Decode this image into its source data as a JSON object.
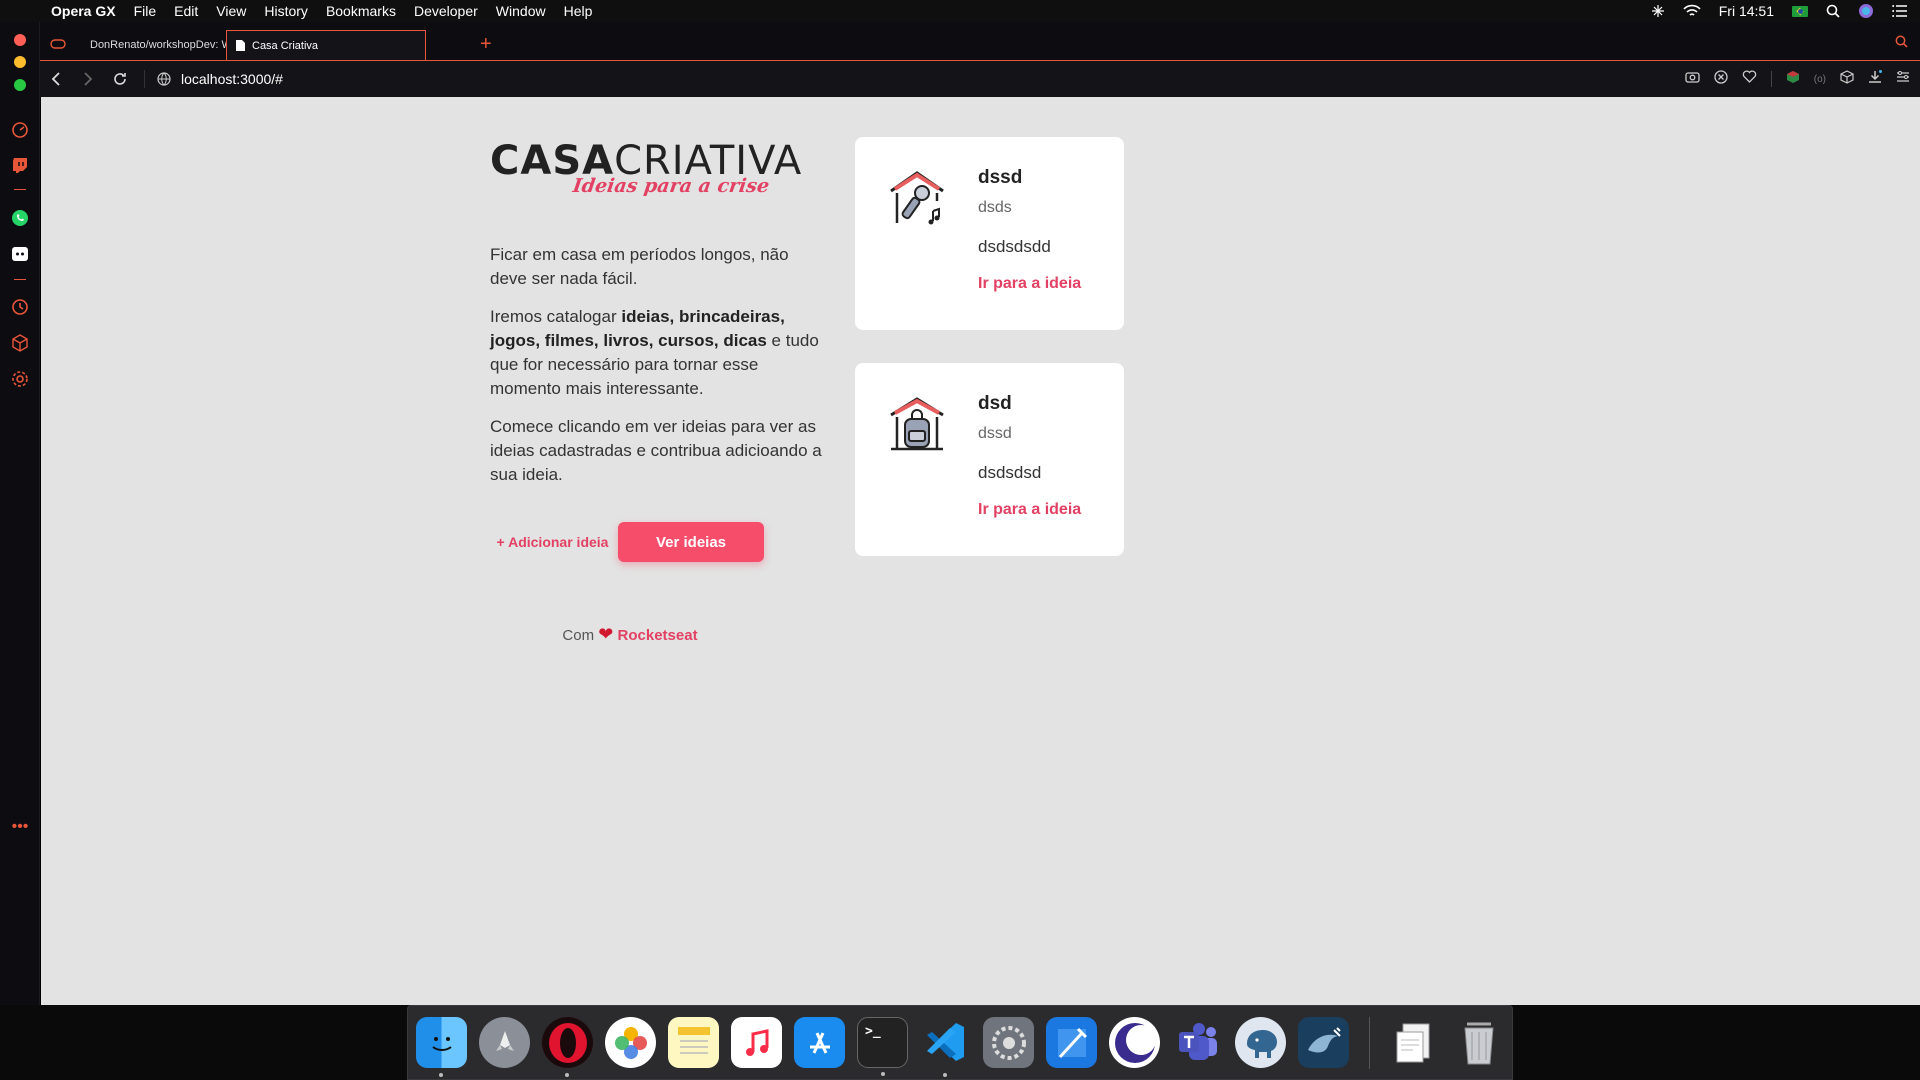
{
  "menubar": {
    "app_name": "Opera GX",
    "items": [
      "File",
      "Edit",
      "View",
      "History",
      "Bookmarks",
      "Developer",
      "Window",
      "Help"
    ],
    "clock": "Fri 14:51"
  },
  "tabs": [
    {
      "label": "DonRenato/workshopDev: Work",
      "icon": "github-icon"
    },
    {
      "label": "Casa Criativa",
      "icon": "page-icon"
    }
  ],
  "address": {
    "url": "localhost:3000/#"
  },
  "page": {
    "logo": {
      "bold": "CASA",
      "light": "CRIATIVA",
      "tagline": "Ideias para a crise"
    },
    "p1": "Ficar em casa em períodos longos, não deve ser nada fácil.",
    "p2": {
      "prefix": "Iremos catalogar ",
      "bold": "ideias, brincadeiras, jogos, filmes, livros, cursos, dicas",
      "suffix": " e tudo que for necessário para tornar esse momento mais interessante."
    },
    "p3": "Comece clicando em ver ideias para ver as ideias cadastradas e contribua adicioando a sua ideia.",
    "add_button": "+ Adicionar ideia",
    "see_button": "Ver ideias",
    "footer": {
      "prefix": "Com",
      "heart": "❤",
      "brand": "Rocketseat"
    }
  },
  "cards": [
    {
      "title": "dssd",
      "category": "dsds",
      "description": "dsdsdsdd",
      "link": "Ir para a ideia",
      "icon": "karaoke-house-icon"
    },
    {
      "title": "dsd",
      "category": "dssd",
      "description": "dsdsdsd",
      "link": "Ir para a ideia",
      "icon": "backpack-house-icon"
    }
  ],
  "colors": {
    "accent": "#e34163",
    "button": "#f64d6b",
    "opera_accent": "#e8563a",
    "page_bg": "#e3e3e3"
  },
  "dock": {
    "apps": [
      "finder-icon",
      "launchpad-icon",
      "opera-icon",
      "photos-icon",
      "notes-icon",
      "music-icon",
      "app-store-icon",
      "terminal-icon",
      "vscode-icon",
      "system-preferences-icon",
      "xcode-icon",
      "eclipse-icon",
      "teams-icon",
      "postgres-icon",
      "mysql-workbench-icon",
      "pdf-icon",
      "trash-icon"
    ]
  }
}
